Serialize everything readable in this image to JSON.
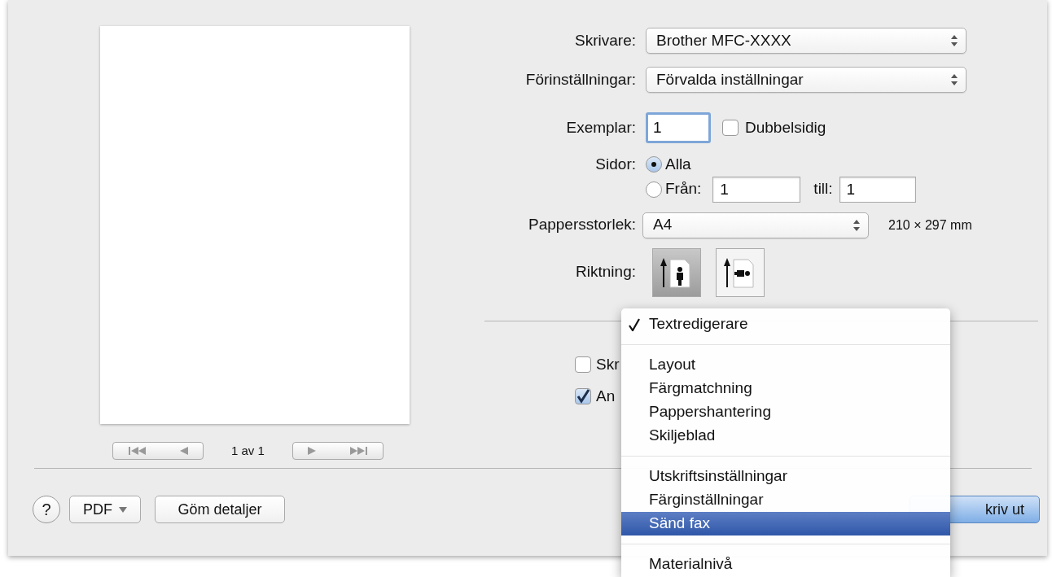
{
  "preview": {
    "page_indicator": "1 av 1"
  },
  "form": {
    "printer": {
      "label": "Skrivare:",
      "value": "Brother MFC-XXXX"
    },
    "presets": {
      "label": "Förinställningar:",
      "value": "Förvalda inställningar"
    },
    "copies": {
      "label": "Exemplar:",
      "value": "1",
      "focused": true
    },
    "duplex": {
      "label": "Dubbelsidig",
      "checked": false
    },
    "pages": {
      "label": "Sidor:",
      "options": [
        {
          "label": "Alla",
          "selected": true
        },
        {
          "label": "Från:",
          "selected": false
        }
      ],
      "from": "1",
      "to_label": "till:",
      "to": "1"
    },
    "paper_size": {
      "label": "Pappersstorlek:",
      "value": "A4",
      "dimensions": "210 × 297 mm"
    },
    "orientation": {
      "label": "Riktning:",
      "options": [
        {
          "kind": "portrait",
          "selected": true
        },
        {
          "kind": "landscape",
          "selected": false
        }
      ]
    }
  },
  "options": [
    {
      "label": "Skr",
      "checked": false
    },
    {
      "label": "An",
      "checked": true
    }
  ],
  "menu": {
    "groups": [
      [
        {
          "label": "Textredigerare",
          "checked": true,
          "selected": false
        }
      ],
      [
        {
          "label": "Layout",
          "checked": false,
          "selected": false
        },
        {
          "label": "Färgmatchning",
          "checked": false,
          "selected": false
        },
        {
          "label": "Pappershantering",
          "checked": false,
          "selected": false
        },
        {
          "label": "Skiljeblad",
          "checked": false,
          "selected": false
        }
      ],
      [
        {
          "label": "Utskriftsinställningar",
          "checked": false,
          "selected": false
        },
        {
          "label": "Färginställningar",
          "checked": false,
          "selected": false
        },
        {
          "label": "Sänd fax",
          "checked": false,
          "selected": true
        }
      ],
      [
        {
          "label": "Materialnivå",
          "checked": false,
          "selected": false
        }
      ]
    ]
  },
  "footer": {
    "help": "?",
    "pdf": "PDF",
    "hide_details": "Göm detaljer",
    "print": "kriv ut"
  }
}
